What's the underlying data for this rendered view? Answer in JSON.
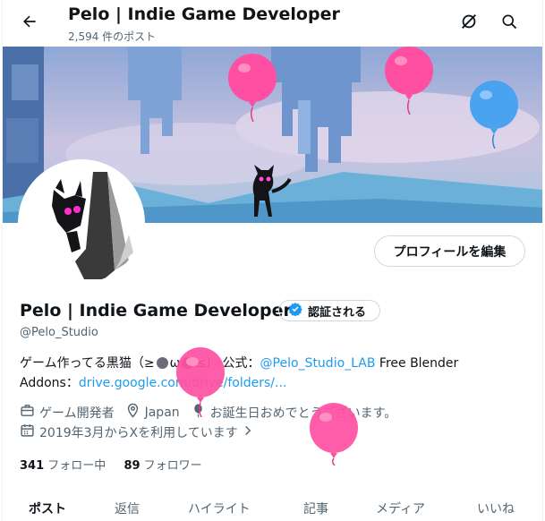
{
  "header": {
    "title": "Pelo | Indie Game Developer",
    "post_count": "2,594 件のポスト"
  },
  "icons": {
    "back": "arrow-left-icon",
    "grok": "grok-slash-icon",
    "search": "search-icon",
    "verified": "verified-badge-icon",
    "profession": "briefcase-icon",
    "location": "location-pin-icon",
    "birthday": "balloon-icon",
    "joined": "calendar-icon",
    "chevron": "chevron-right-icon"
  },
  "profile": {
    "edit_button": "プロフィールを編集",
    "name": "Pelo | Indie Game Developer",
    "verified_label": "認証される",
    "handle": "@Pelo_Studio",
    "bio_part1": "ゲーム作ってる黒猫（≥",
    "bio_part2": "ω",
    "bio_part3": "≤） 公式：",
    "bio_link1": "@Pelo_Studio_LAB",
    "bio_part4": " Free Blender",
    "bio_part5": "Addons：",
    "bio_link2": "drive.google.com/drive/folders/...",
    "profession": "ゲーム開発者",
    "location": "Japan",
    "birthday": "お誕生日おめでとうございます。",
    "joined": "2019年3月からXを利用しています",
    "following_count": "341",
    "following_label": "フォロー中",
    "followers_count": "89",
    "followers_label": "フォロワー"
  },
  "tabs": [
    "ポスト",
    "返信",
    "ハイライト",
    "記事",
    "メディア",
    "いいね"
  ],
  "colors": {
    "accent": "#1d9bf0",
    "balloon_pink": "#ff4fa3",
    "balloon_blue": "#4aa3f0"
  }
}
